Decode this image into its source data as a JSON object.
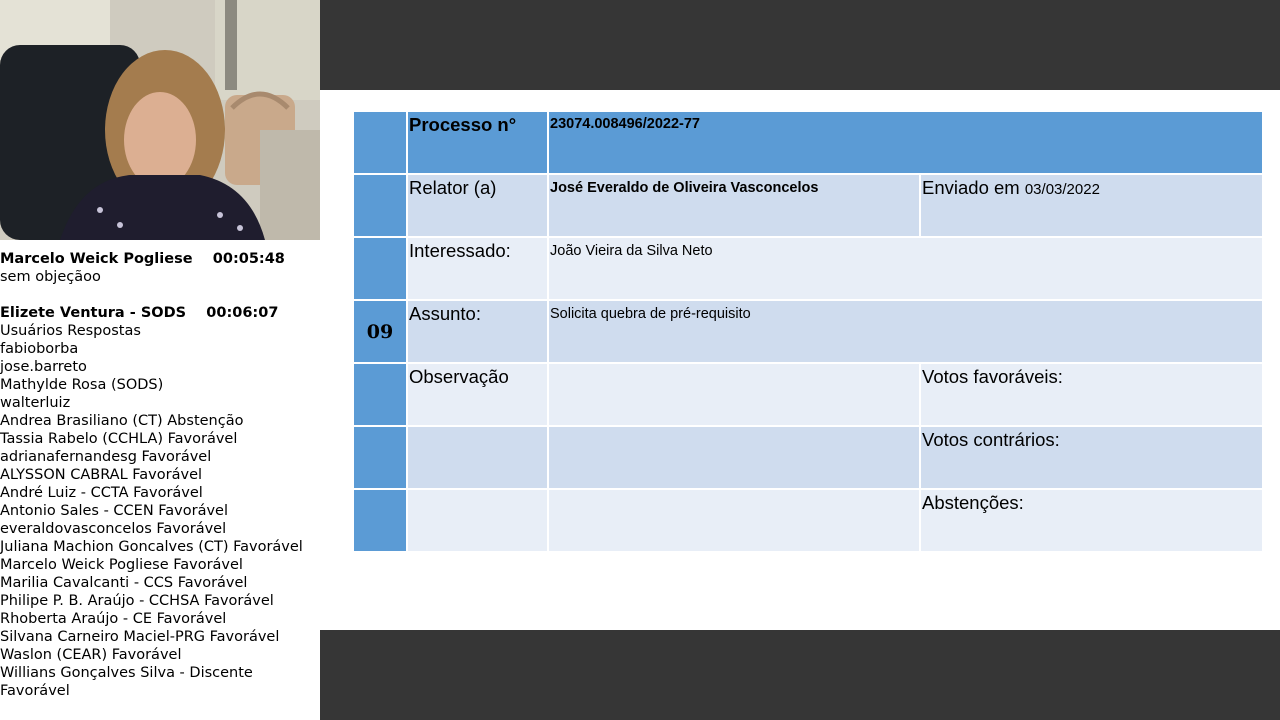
{
  "chat": {
    "messages": [
      {
        "author": "Marcelo Weick Pogliese",
        "time": "00:05:48",
        "text": "sem objeçãoo"
      },
      {
        "author": "Elizete Ventura - SODS",
        "time": "00:06:07",
        "text": "Usuários Respostas"
      }
    ],
    "responses": [
      "fabioborba",
      "jose.barreto",
      "Mathylde Rosa (SODS)",
      "walterluiz",
      "Andrea Brasiliano (CT) Abstenção",
      "Tassia Rabelo (CCHLA) Favorável",
      "adrianafernandesg Favorável",
      "ALYSSON CABRAL Favorável",
      "André Luiz - CCTA Favorável",
      "Antonio Sales - CCEN Favorável",
      "everaldovasconcelos Favorável",
      "Juliana Machion Goncalves (CT) Favorável",
      "Marcelo Weick Pogliese Favorável",
      "Marilia Cavalcanti - CCS Favorável",
      "Philipe P. B. Araújo - CCHSA Favorável",
      "Rhoberta Araújo - CE Favorável",
      "Silvana Carneiro Maciel-PRG Favorável",
      "Waslon (CEAR) Favorável",
      "Willians Gonçalves Silva - Discente Favorável"
    ]
  },
  "slide": {
    "item_number": "09",
    "processo_label": "Processo n°",
    "processo_value": "23074.008496/2022-77",
    "relator_label": "Relator (a)",
    "relator_value": "José Everaldo de Oliveira Vasconcelos",
    "enviado_label": "Enviado em",
    "enviado_value": "03/03/2022",
    "interessado_label": "Interessado:",
    "interessado_value": "João Vieira da Silva Neto",
    "assunto_label": "Assunto:",
    "assunto_value": "Solicita quebra de pré-requisito",
    "observacao_label": "Observação",
    "votos_favoraveis_label": "Votos favoráveis:",
    "votos_contrarios_label": "Votos contrários:",
    "abstencoes_label": "Abstenções:"
  },
  "colors": {
    "header_blue": "#5b9bd5",
    "row_dark": "#cfdcee",
    "row_light": "#e8eef7",
    "share_bar": "#363636"
  }
}
